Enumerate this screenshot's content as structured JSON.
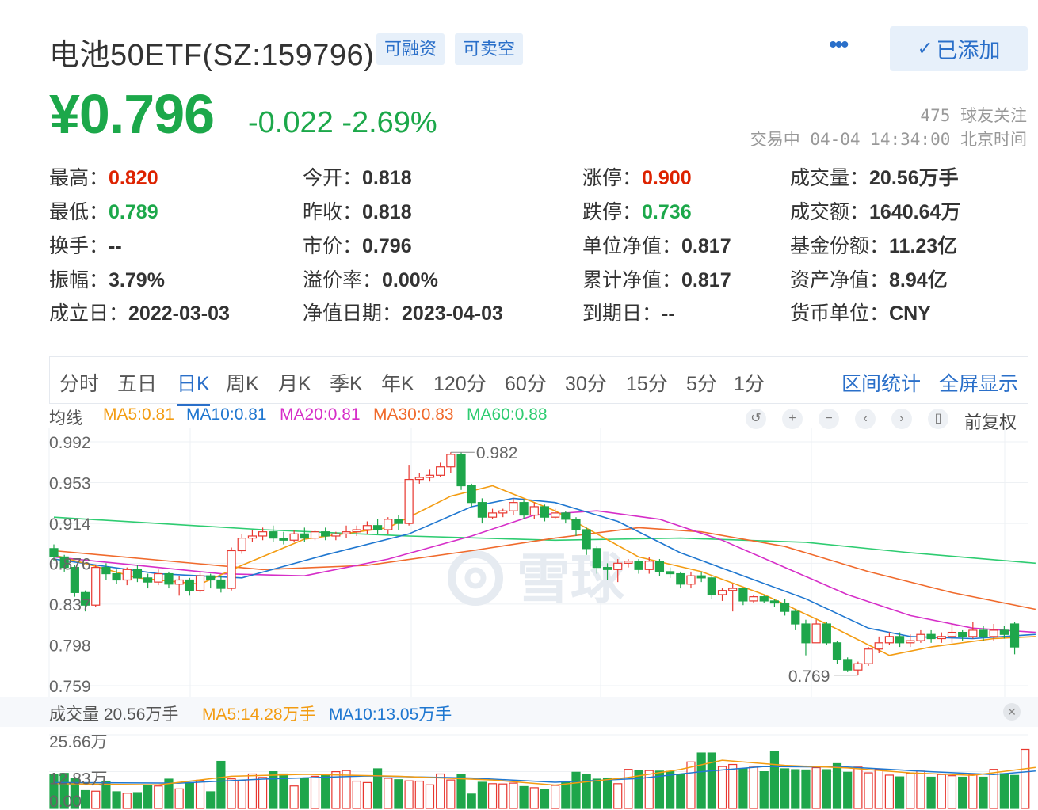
{
  "header": {
    "title": "电池50ETF(SZ:159796)",
    "tags": [
      "可融资",
      "可卖空"
    ],
    "more_label": "•••",
    "added_label": "已添加"
  },
  "quote": {
    "price": "¥0.796",
    "change": "-0.022",
    "change_pct": "-2.69%",
    "followers": "475 球友关注",
    "status": "交易中 04-04 14:34:00 北京时间"
  },
  "stats": [
    {
      "label": "最高",
      "value": "0.820",
      "color": "red"
    },
    {
      "label": "今开",
      "value": "0.818",
      "color": "normal"
    },
    {
      "label": "涨停",
      "value": "0.900",
      "color": "red"
    },
    {
      "label": "成交量",
      "value": "20.56万手",
      "color": "normal"
    },
    {
      "label": "最低",
      "value": "0.789",
      "color": "green"
    },
    {
      "label": "昨收",
      "value": "0.818",
      "color": "normal"
    },
    {
      "label": "跌停",
      "value": "0.736",
      "color": "green"
    },
    {
      "label": "成交额",
      "value": "1640.64万",
      "color": "normal"
    },
    {
      "label": "换手",
      "value": "--",
      "color": "normal"
    },
    {
      "label": "市价",
      "value": "0.796",
      "color": "normal"
    },
    {
      "label": "单位净值",
      "value": "0.817",
      "color": "normal"
    },
    {
      "label": "基金份额",
      "value": "11.23亿",
      "color": "normal"
    },
    {
      "label": "振幅",
      "value": "3.79%",
      "color": "normal"
    },
    {
      "label": "溢价率",
      "value": "0.00%",
      "color": "normal"
    },
    {
      "label": "累计净值",
      "value": "0.817",
      "color": "normal"
    },
    {
      "label": "资产净值",
      "value": "8.94亿",
      "color": "normal"
    },
    {
      "label": "成立日",
      "value": "2022-03-03",
      "color": "normal"
    },
    {
      "label": "净值日期",
      "value": "2023-04-03",
      "color": "normal"
    },
    {
      "label": "到期日",
      "value": "--",
      "color": "normal"
    },
    {
      "label": "货币单位",
      "value": "CNY",
      "color": "normal"
    }
  ],
  "chart_tabs": [
    "分时",
    "五日",
    "日K",
    "周K",
    "月K",
    "季K",
    "年K",
    "120分",
    "60分",
    "30分",
    "15分",
    "5分",
    "1分"
  ],
  "active_tab": "日K",
  "chart_links": [
    "区间统计",
    "全屏显示"
  ],
  "ma_legend": {
    "label": "均线",
    "items": [
      {
        "text": "MA5:0.81",
        "color": "#f39c12"
      },
      {
        "text": "MA10:0.81",
        "color": "#1f77d0"
      },
      {
        "text": "MA20:0.81",
        "color": "#d62ec8"
      },
      {
        "text": "MA30:0.83",
        "color": "#f06a2c"
      },
      {
        "text": "MA60:0.88",
        "color": "#2ecc71"
      }
    ]
  },
  "toolbar": {
    "icons": [
      "undo-icon",
      "zoom-in-icon",
      "zoom-out-icon",
      "prev-icon",
      "next-icon",
      "candle-icon"
    ],
    "adjust_label": "前复权"
  },
  "watermark": "雪球",
  "volume_legend": {
    "label": "成交量 20.56万手",
    "ma5": "MA5:14.28万手",
    "ma10": "MA10:13.05万手"
  },
  "colors": {
    "up": "#e8372f",
    "down": "#1ea64b",
    "accent": "#2a6fc9"
  },
  "chart_data": [
    {
      "type": "candlestick",
      "yaxis_ticks": [
        "0.992",
        "0.953",
        "0.914",
        "0.876",
        "0.837",
        "0.798",
        "0.759"
      ],
      "ylim": [
        0.759,
        0.992
      ],
      "annotations": [
        {
          "text": "0.982",
          "role": "high"
        },
        {
          "text": "0.769",
          "role": "low"
        }
      ],
      "series_names": [
        "MA5",
        "MA10",
        "MA20",
        "MA30",
        "MA60"
      ],
      "candles": [
        [
          0.89,
          0.882,
          0.894,
          0.878
        ],
        [
          0.882,
          0.872,
          0.884,
          0.868
        ],
        [
          0.872,
          0.848,
          0.874,
          0.844
        ],
        [
          0.848,
          0.836,
          0.85,
          0.83
        ],
        [
          0.836,
          0.872,
          0.874,
          0.834
        ],
        [
          0.872,
          0.866,
          0.876,
          0.86
        ],
        [
          0.866,
          0.86,
          0.87,
          0.856
        ],
        [
          0.86,
          0.87,
          0.872,
          0.855
        ],
        [
          0.87,
          0.862,
          0.874,
          0.858
        ],
        [
          0.862,
          0.858,
          0.866,
          0.852
        ],
        [
          0.858,
          0.866,
          0.87,
          0.855
        ],
        [
          0.866,
          0.856,
          0.868,
          0.852
        ],
        [
          0.856,
          0.86,
          0.864,
          0.845
        ],
        [
          0.86,
          0.85,
          0.862,
          0.845
        ],
        [
          0.85,
          0.864,
          0.868,
          0.848
        ],
        [
          0.864,
          0.86,
          0.866,
          0.852
        ],
        [
          0.86,
          0.852,
          0.864,
          0.848
        ],
        [
          0.852,
          0.888,
          0.891,
          0.85
        ],
        [
          0.888,
          0.9,
          0.904,
          0.885
        ],
        [
          0.9,
          0.902,
          0.908,
          0.896
        ],
        [
          0.902,
          0.906,
          0.91,
          0.898
        ],
        [
          0.906,
          0.9,
          0.912,
          0.896
        ],
        [
          0.9,
          0.898,
          0.906,
          0.894
        ],
        [
          0.898,
          0.904,
          0.908,
          0.896
        ],
        [
          0.904,
          0.9,
          0.91,
          0.896
        ],
        [
          0.9,
          0.906,
          0.908,
          0.898
        ],
        [
          0.906,
          0.902,
          0.91,
          0.898
        ],
        [
          0.902,
          0.904,
          0.906,
          0.898
        ],
        [
          0.904,
          0.906,
          0.912,
          0.9
        ],
        [
          0.906,
          0.908,
          0.912,
          0.902
        ],
        [
          0.908,
          0.912,
          0.916,
          0.904
        ],
        [
          0.912,
          0.908,
          0.918,
          0.904
        ],
        [
          0.908,
          0.918,
          0.92,
          0.904
        ],
        [
          0.918,
          0.914,
          0.922,
          0.908
        ],
        [
          0.914,
          0.956,
          0.97,
          0.912
        ],
        [
          0.956,
          0.958,
          0.962,
          0.952
        ],
        [
          0.958,
          0.96,
          0.966,
          0.954
        ],
        [
          0.96,
          0.968,
          0.972,
          0.958
        ],
        [
          0.968,
          0.98,
          0.982,
          0.962
        ],
        [
          0.98,
          0.95,
          0.982,
          0.946
        ],
        [
          0.95,
          0.934,
          0.952,
          0.93
        ],
        [
          0.934,
          0.92,
          0.938,
          0.914
        ],
        [
          0.92,
          0.924,
          0.928,
          0.918
        ],
        [
          0.924,
          0.926,
          0.928,
          0.92
        ],
        [
          0.926,
          0.934,
          0.938,
          0.922
        ],
        [
          0.934,
          0.922,
          0.936,
          0.918
        ],
        [
          0.922,
          0.93,
          0.934,
          0.918
        ],
        [
          0.93,
          0.92,
          0.932,
          0.916
        ],
        [
          0.92,
          0.924,
          0.928,
          0.918
        ],
        [
          0.924,
          0.918,
          0.926,
          0.914
        ],
        [
          0.918,
          0.908,
          0.92,
          0.902
        ],
        [
          0.908,
          0.89,
          0.91,
          0.884
        ],
        [
          0.89,
          0.872,
          0.892,
          0.866
        ],
        [
          0.872,
          0.87,
          0.876,
          0.86
        ],
        [
          0.87,
          0.876,
          0.88,
          0.858
        ],
        [
          0.876,
          0.878,
          0.88,
          0.872
        ],
        [
          0.878,
          0.87,
          0.88,
          0.866
        ],
        [
          0.87,
          0.878,
          0.882,
          0.866
        ],
        [
          0.878,
          0.868,
          0.88,
          0.864
        ],
        [
          0.868,
          0.866,
          0.872,
          0.862
        ],
        [
          0.866,
          0.856,
          0.868,
          0.852
        ],
        [
          0.856,
          0.864,
          0.868,
          0.852
        ],
        [
          0.864,
          0.862,
          0.868,
          0.858
        ],
        [
          0.862,
          0.846,
          0.864,
          0.842
        ],
        [
          0.846,
          0.85,
          0.852,
          0.84
        ],
        [
          0.85,
          0.852,
          0.856,
          0.83
        ],
        [
          0.852,
          0.84,
          0.852,
          0.836
        ],
        [
          0.84,
          0.844,
          0.846,
          0.838
        ],
        [
          0.844,
          0.84,
          0.846,
          0.838
        ],
        [
          0.84,
          0.838,
          0.842,
          0.834
        ],
        [
          0.838,
          0.83,
          0.842,
          0.826
        ],
        [
          0.83,
          0.818,
          0.832,
          0.812
        ],
        [
          0.818,
          0.8,
          0.822,
          0.788
        ],
        [
          0.8,
          0.818,
          0.822,
          0.806
        ],
        [
          0.818,
          0.8,
          0.82,
          0.798
        ],
        [
          0.8,
          0.784,
          0.802,
          0.78
        ],
        [
          0.784,
          0.774,
          0.786,
          0.772
        ],
        [
          0.774,
          0.78,
          0.782,
          0.769
        ],
        [
          0.78,
          0.794,
          0.796,
          0.778
        ],
        [
          0.794,
          0.8,
          0.806,
          0.79
        ],
        [
          0.8,
          0.806,
          0.81,
          0.798
        ],
        [
          0.806,
          0.8,
          0.81,
          0.796
        ],
        [
          0.8,
          0.802,
          0.808,
          0.796
        ],
        [
          0.802,
          0.808,
          0.812,
          0.8
        ],
        [
          0.808,
          0.804,
          0.812,
          0.8
        ],
        [
          0.804,
          0.806,
          0.81,
          0.8
        ],
        [
          0.806,
          0.81,
          0.818,
          0.8
        ],
        [
          0.81,
          0.806,
          0.812,
          0.802
        ],
        [
          0.806,
          0.812,
          0.82,
          0.804
        ],
        [
          0.812,
          0.806,
          0.816,
          0.802
        ],
        [
          0.806,
          0.812,
          0.818,
          0.802
        ],
        [
          0.812,
          0.808,
          0.816,
          0.804
        ],
        [
          0.818,
          0.796,
          0.82,
          0.789
        ]
      ],
      "ma": {
        "MA5": [
          [
            0,
            0.884
          ],
          [
            8,
            0.862
          ],
          [
            14,
            0.856
          ],
          [
            18,
            0.874
          ],
          [
            24,
            0.899
          ],
          [
            32,
            0.91
          ],
          [
            38,
            0.94
          ],
          [
            42,
            0.95
          ],
          [
            48,
            0.926
          ],
          [
            56,
            0.882
          ],
          [
            62,
            0.868
          ],
          [
            68,
            0.846
          ],
          [
            74,
            0.818
          ],
          [
            80,
            0.788
          ],
          [
            84,
            0.796
          ],
          [
            90,
            0.804
          ],
          [
            94,
            0.806
          ]
        ],
        "MA10": [
          [
            0,
            0.88
          ],
          [
            10,
            0.866
          ],
          [
            18,
            0.862
          ],
          [
            26,
            0.884
          ],
          [
            34,
            0.904
          ],
          [
            40,
            0.93
          ],
          [
            44,
            0.938
          ],
          [
            48,
            0.934
          ],
          [
            54,
            0.916
          ],
          [
            60,
            0.886
          ],
          [
            66,
            0.864
          ],
          [
            72,
            0.842
          ],
          [
            78,
            0.814
          ],
          [
            82,
            0.806
          ],
          [
            88,
            0.804
          ],
          [
            94,
            0.808
          ]
        ],
        "MA20": [
          [
            0,
            0.882
          ],
          [
            16,
            0.866
          ],
          [
            24,
            0.864
          ],
          [
            32,
            0.88
          ],
          [
            40,
            0.902
          ],
          [
            46,
            0.922
          ],
          [
            52,
            0.926
          ],
          [
            58,
            0.918
          ],
          [
            64,
            0.898
          ],
          [
            70,
            0.872
          ],
          [
            76,
            0.846
          ],
          [
            82,
            0.826
          ],
          [
            88,
            0.814
          ],
          [
            94,
            0.81
          ]
        ],
        "MA30": [
          [
            0,
            0.888
          ],
          [
            20,
            0.87
          ],
          [
            30,
            0.874
          ],
          [
            40,
            0.888
          ],
          [
            48,
            0.9
          ],
          [
            56,
            0.91
          ],
          [
            62,
            0.906
          ],
          [
            70,
            0.892
          ],
          [
            78,
            0.868
          ],
          [
            86,
            0.848
          ],
          [
            94,
            0.832
          ]
        ],
        "MA60": [
          [
            0,
            0.92
          ],
          [
            20,
            0.908
          ],
          [
            34,
            0.902
          ],
          [
            48,
            0.898
          ],
          [
            60,
            0.9
          ],
          [
            72,
            0.896
          ],
          [
            82,
            0.886
          ],
          [
            94,
            0.876
          ]
        ]
      }
    },
    {
      "type": "bar",
      "title": "成交量",
      "yaxis_ticks": [
        "25.66万",
        "12.83万",
        "0.00"
      ],
      "ylim": [
        0,
        25.66
      ],
      "values": [
        11.8,
        12.2,
        10.5,
        6.2,
        6.0,
        9.5,
        5.8,
        5.3,
        5.5,
        8.0,
        7.8,
        10.2,
        6.8,
        9.0,
        9.8,
        5.8,
        16.4,
        10.3,
        9.7,
        12.0,
        10.8,
        12.8,
        12.0,
        7.8,
        10.5,
        11.2,
        11.5,
        12.8,
        13.2,
        9.5,
        9.0,
        13.8,
        10.5,
        10.0,
        9.6,
        9.5,
        8.2,
        12.0,
        9.9,
        11.8,
        5.0,
        9.1,
        8.6,
        8.5,
        8.8,
        7.6,
        7.2,
        6.6,
        8.0,
        9.5,
        12.6,
        11.7,
        10.2,
        10.6,
        8.6,
        13.6,
        13.2,
        13.2,
        13.0,
        12.9,
        11.8,
        16.2,
        19.3,
        19.3,
        14.6,
        15.3,
        13.9,
        14.7,
        12.8,
        19.8,
        13.8,
        13.5,
        13.4,
        14.2,
        13.5,
        15.6,
        12.6,
        14.4,
        12.4,
        13.6,
        11.6,
        11.0,
        12.2,
        13.0,
        10.9,
        11.8,
        11.4,
        10.9,
        11.9,
        10.9,
        13.6,
        12.1,
        11.5,
        20.56
      ],
      "ma5_points": [
        [
          0,
          8.6
        ],
        [
          10,
          8.2
        ],
        [
          17,
          11.2
        ],
        [
          24,
          11.9
        ],
        [
          33,
          11.2
        ],
        [
          42,
          9.9
        ],
        [
          48,
          8.1
        ],
        [
          55,
          10.8
        ],
        [
          60,
          13.6
        ],
        [
          64,
          16.8
        ],
        [
          70,
          15.0
        ],
        [
          76,
          14.1
        ],
        [
          82,
          12.4
        ],
        [
          88,
          11.5
        ],
        [
          94,
          14.28
        ]
      ],
      "ma10_points": [
        [
          0,
          9.0
        ],
        [
          12,
          8.8
        ],
        [
          20,
          10.2
        ],
        [
          30,
          11.3
        ],
        [
          40,
          10.6
        ],
        [
          48,
          9.1
        ],
        [
          56,
          10.4
        ],
        [
          62,
          12.8
        ],
        [
          68,
          14.6
        ],
        [
          76,
          14.4
        ],
        [
          84,
          12.8
        ],
        [
          90,
          11.8
        ],
        [
          94,
          13.05
        ]
      ]
    }
  ]
}
